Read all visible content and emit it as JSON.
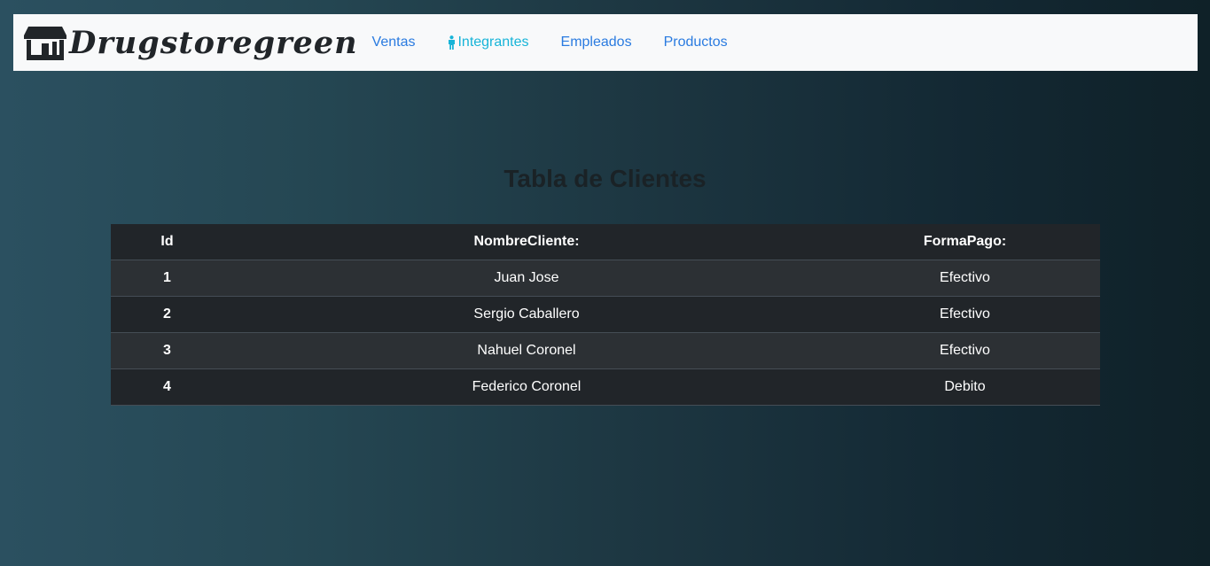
{
  "navbar": {
    "brand": "Drugstoregreen",
    "brand_icon": "store-icon",
    "links": [
      {
        "label": "Ventas"
      },
      {
        "label": "Integrantes",
        "icon": "person-icon",
        "active": true
      },
      {
        "label": "Empleados"
      },
      {
        "label": "Productos"
      }
    ]
  },
  "page": {
    "title": "Tabla de Clientes"
  },
  "table": {
    "headers": [
      "Id",
      "NombreCliente:",
      "FormaPago:"
    ],
    "rows": [
      [
        "1",
        "Juan Jose",
        "Efectivo"
      ],
      [
        "2",
        "Sergio Caballero",
        "Efectivo"
      ],
      [
        "3",
        "Nahuel Coronel",
        "Efectivo"
      ],
      [
        "4",
        "Federico Coronel",
        "Debito"
      ]
    ]
  },
  "colors": {
    "nav_bg": "#f8f9fa",
    "link": "#2a7be0",
    "active_link": "#17b4d8",
    "table_dark": "#212529",
    "table_striped": "#2c3034"
  }
}
